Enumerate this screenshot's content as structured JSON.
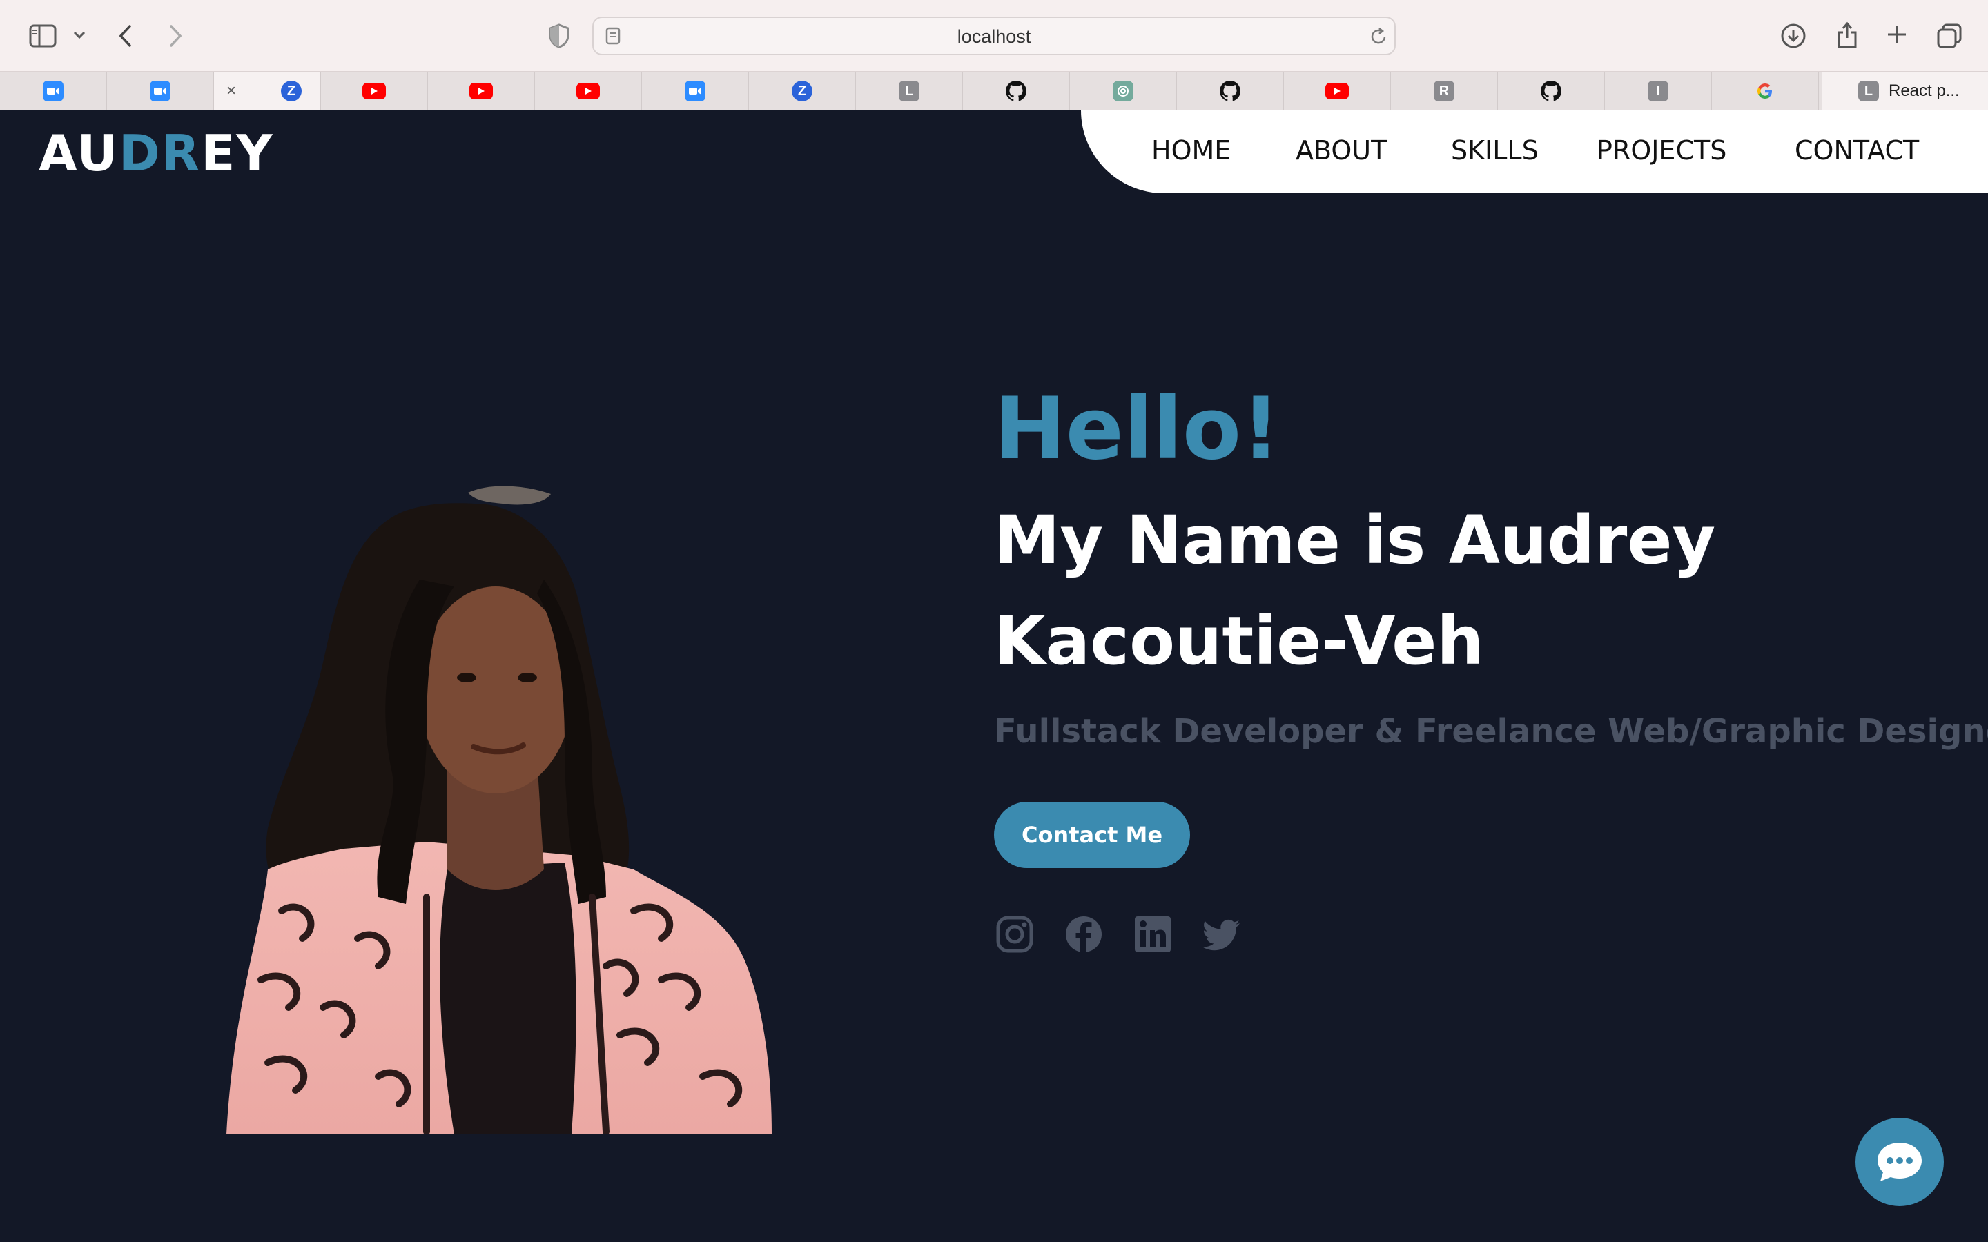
{
  "browser": {
    "url": "localhost",
    "tabs": [
      {
        "icon": "zoom-icon"
      },
      {
        "icon": "zoom-icon"
      },
      {
        "icon": "zoom-z-icon",
        "active": true,
        "close": "×"
      },
      {
        "icon": "youtube-icon"
      },
      {
        "icon": "youtube-icon"
      },
      {
        "icon": "youtube-icon"
      },
      {
        "icon": "zoom-icon"
      },
      {
        "icon": "zoom-z-icon"
      },
      {
        "icon": "letter-icon",
        "letter": "L"
      },
      {
        "icon": "github-icon"
      },
      {
        "icon": "chatgpt-icon"
      },
      {
        "icon": "github-icon"
      },
      {
        "icon": "youtube-icon"
      },
      {
        "icon": "letter-icon",
        "letter": "R"
      },
      {
        "icon": "github-icon"
      },
      {
        "icon": "letter-icon",
        "letter": "I"
      },
      {
        "icon": "google-icon"
      },
      {
        "icon": "letter-icon",
        "letter": "L",
        "title": "React p..."
      }
    ]
  },
  "site": {
    "logo": {
      "part1": "AU",
      "part2": "DR",
      "part3": "EY"
    },
    "nav": [
      "HOME",
      "ABOUT",
      "SKILLS",
      "PROJECTS",
      "CONTACT"
    ],
    "hero": {
      "greeting": "Hello!",
      "name_line1": "My Name is Audrey",
      "name_line2": "Kacoutie-Veh",
      "role": "Fullstack Developer & Freelance Web/Graphic Designer",
      "cta": "Contact Me"
    },
    "socials": [
      "instagram-icon",
      "facebook-icon",
      "linkedin-icon",
      "twitter-icon"
    ],
    "colors": {
      "background": "#131827",
      "accent": "#3b8bb0",
      "muted": "#4a5263",
      "nav_bg": "#ffffff"
    }
  }
}
